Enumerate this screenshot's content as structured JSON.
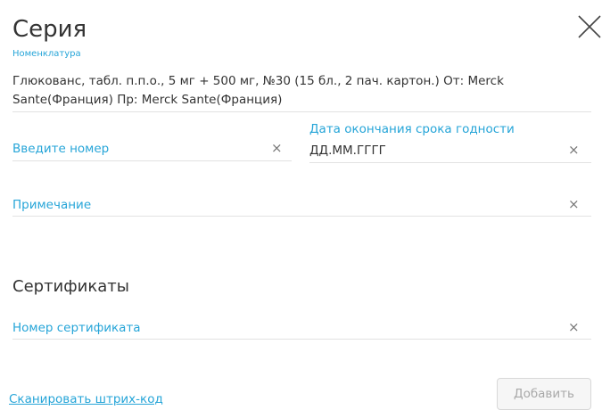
{
  "dialog": {
    "title": "Серия",
    "nomenclature_label": "Номенклатура",
    "nomenclature_value": "Глюкованс, табл. п.п.о., 5 мг + 500 мг, №30 (15 бл., 2 пач. картон.) От: Merck Sante(Франция) Пр: Merck Sante(Франция)"
  },
  "fields": {
    "number_placeholder": "Введите номер",
    "expiry_label": "Дата окончания срока годности",
    "expiry_value": "ДД.ММ.ГГГГ",
    "note_placeholder": "Примечание"
  },
  "certificates": {
    "title": "Сертификаты",
    "number_placeholder": "Номер сертификата"
  },
  "actions": {
    "scan_link": "Сканировать штрих-код",
    "add_button": "Добавить"
  },
  "icons": {
    "clear": "×"
  },
  "colors": {
    "accent": "#26a5d8",
    "text": "#333333",
    "divider": "#e2e2e2"
  }
}
